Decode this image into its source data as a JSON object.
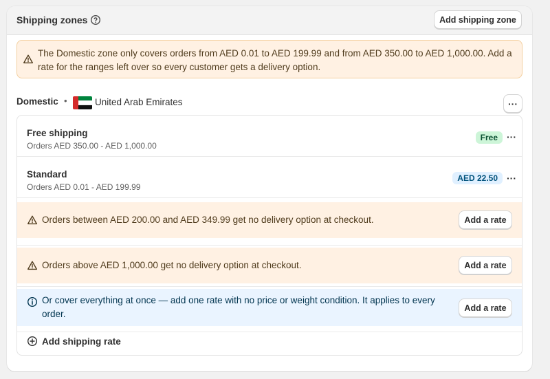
{
  "header": {
    "title": "Shipping zones",
    "add_zone_label": "Add shipping zone"
  },
  "warning": {
    "text": "The Domestic zone only covers orders from AED 0.01 to AED 199.99 and from AED 350.00 to AED 1,000.00. Add a rate for the ranges left over so every customer gets a delivery option."
  },
  "zone": {
    "name": "Domestic",
    "separator": "•",
    "country": "United Arab Emirates",
    "menu_label": "···"
  },
  "rates": [
    {
      "title": "Free shipping",
      "condition": "Orders AED 350.00 - AED 1,000.00",
      "price": "Free",
      "menu_label": "···"
    },
    {
      "title": "Standard",
      "condition": "Orders AED 0.01 - AED 199.99",
      "price": "AED 22.50",
      "menu_label": "···"
    }
  ],
  "gaps": [
    {
      "text": "Orders between AED 200.00 and AED 349.99 get no delivery option at checkout.",
      "button": "Add a rate"
    },
    {
      "text": "Orders above AED 1,000.00 get no delivery option at checkout.",
      "button": "Add a rate"
    }
  ],
  "info": {
    "text": "Or cover everything at once — add one rate with no price or weight condition. It applies to every order.",
    "button": "Add a rate"
  },
  "add_shipping_rate_label": "Add shipping rate",
  "colors": {
    "warning_bg": "#fff1e3",
    "info_bg": "#eaf4ff",
    "free_badge_bg": "#cdf5d8",
    "price_badge_bg": "#e0f0ff"
  },
  "flag_colors": [
    "#d52b2b",
    "#00843d",
    "#ffffff",
    "#000000"
  ]
}
